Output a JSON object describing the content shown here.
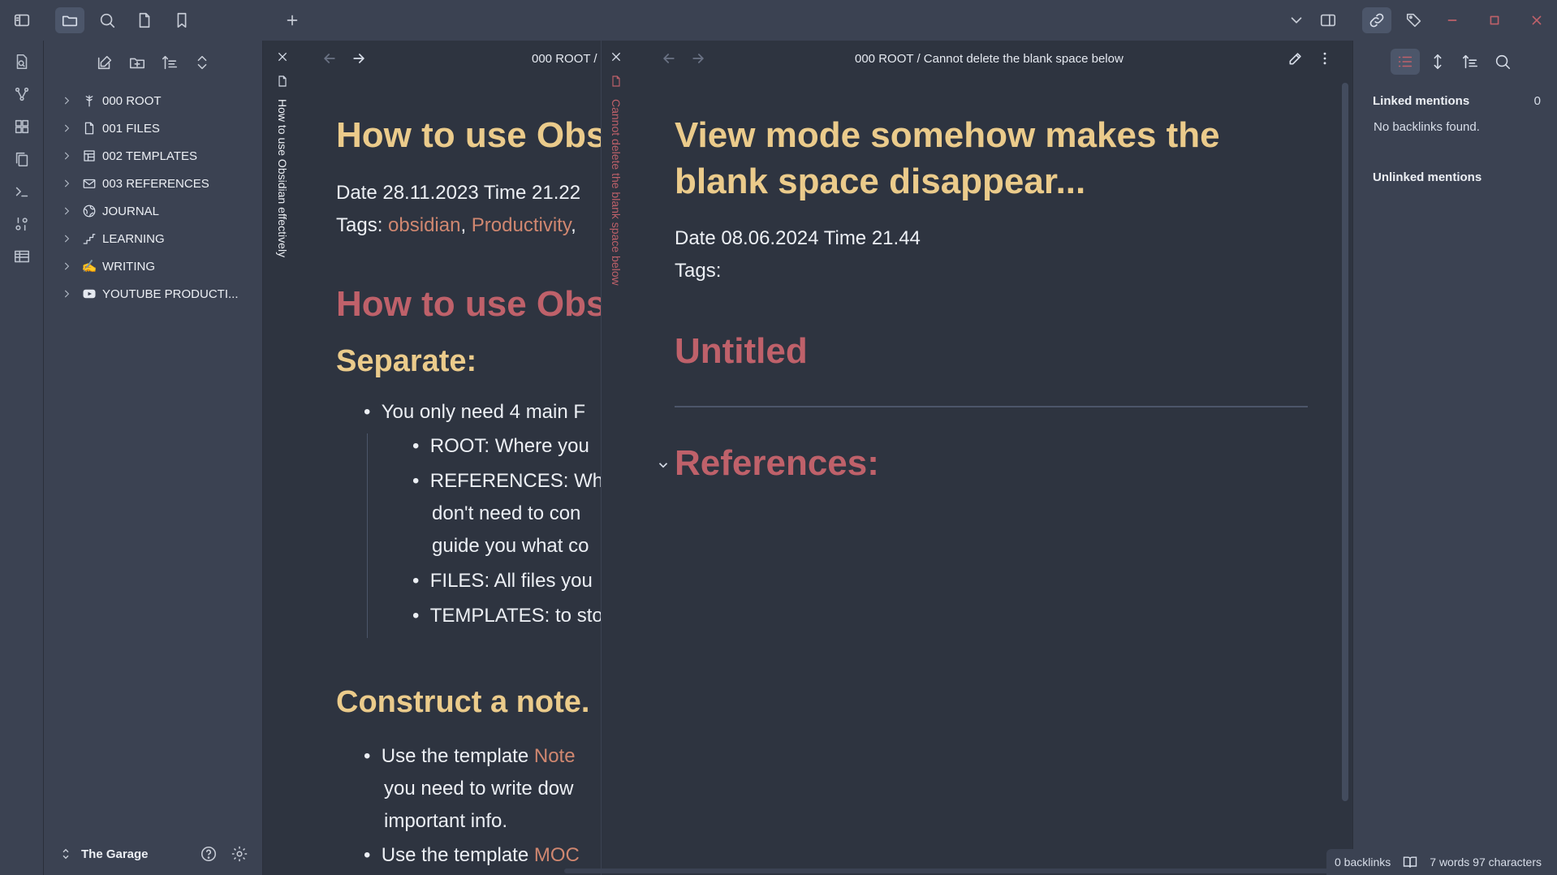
{
  "titlebar": {
    "icons": [
      "sidebar-toggle-icon",
      "folder-icon",
      "search-icon",
      "file-icon",
      "bookmark-icon",
      "plus-icon"
    ],
    "right_icons": [
      "chevron-down-icon",
      "split-view-icon",
      "link-icon",
      "tags-icon",
      "minimize-icon",
      "maximize-icon",
      "close-icon"
    ],
    "window_control_color": "#bf616a"
  },
  "ribbon": {
    "icons": [
      "new-note-icon",
      "graph-view-icon",
      "canvas-icon",
      "copy-icon",
      "terminal-icon",
      "number-icon",
      "table-icon"
    ]
  },
  "explorer": {
    "toolbar_icons": [
      "new-note-icon",
      "new-folder-icon",
      "sort-icon",
      "collapse-icon"
    ],
    "items": [
      {
        "label": "000 ROOT",
        "icon": "tree-icon"
      },
      {
        "label": "001 FILES",
        "icon": "file-icon"
      },
      {
        "label": "002 TEMPLATES",
        "icon": "template-icon"
      },
      {
        "label": "003 REFERENCES",
        "icon": "mail-icon"
      },
      {
        "label": "JOURNAL",
        "icon": "globe-icon"
      },
      {
        "label": "LEARNING",
        "icon": "stairs-icon"
      },
      {
        "label": "WRITING",
        "icon": "writing-hand-icon"
      },
      {
        "label": "YOUTUBE PRODUCTI...",
        "icon": "youtube-icon"
      }
    ],
    "vault_name": "The Garage"
  },
  "spine_left": {
    "title": "How to use Obsidian effectively"
  },
  "spine_right": {
    "title": "Cannot delete the blank space below"
  },
  "left_pane": {
    "breadcrumb": "000 ROOT /",
    "title": "How to use Obs",
    "date_line": "Date 28.11.2023 Time 21.22",
    "tags_label": "Tags:",
    "tag1": "obsidian",
    "tag2": "Productivity",
    "sep": ",",
    "sep2": ",",
    "heading_red": "How to use Obs",
    "heading_separate": "Separate:",
    "bullet1": "You only need 4 main F",
    "sub1": "ROOT: Where you",
    "sub2a": "REFERENCES: Whe",
    "sub2b": "don't need to con",
    "sub2c": "guide you what co",
    "sub3": "FILES: All files you",
    "sub4": "TEMPLATES: to sto",
    "heading_construct": "Construct a note.",
    "bullet2a_pre": "Use the template ",
    "bullet2a_link": "Note",
    "bullet2b": "you need to write dow",
    "bullet2c": "important info.",
    "bullet3_pre": "Use the template ",
    "bullet3_link": "MOC"
  },
  "right_pane": {
    "breadcrumb_root": "000 ROOT",
    "breadcrumb_sep": "/",
    "breadcrumb_note": "Cannot delete the blank space below",
    "title_line1": "View mode somehow makes the",
    "title_line2": "blank space disappear...",
    "date_line": "Date 08.06.2024 Time 21.44",
    "tags_label": "Tags:",
    "heading_untitled": "Untitled",
    "heading_references": "References:"
  },
  "right_sidebar": {
    "icons": [
      "list-icon",
      "vertical-arrows-icon",
      "sort-icon",
      "search-icon"
    ],
    "linked_mentions": "Linked mentions",
    "linked_count": "0",
    "no_backlinks": "No backlinks found.",
    "unlinked_mentions": "Unlinked mentions"
  },
  "statusbar": {
    "backlinks": "0 backlinks",
    "word_count": "7 words 97 characters"
  },
  "colors": {
    "accent_yellow": "#ebcb8b",
    "accent_red": "#bf616a",
    "accent_orange": "#d08770"
  }
}
